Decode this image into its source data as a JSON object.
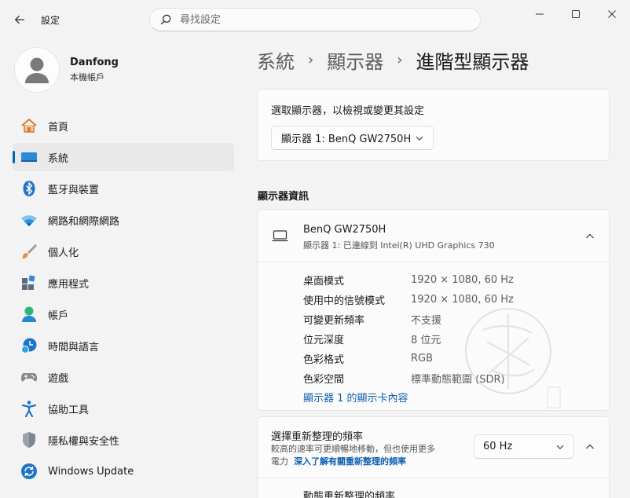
{
  "app": {
    "title": "設定"
  },
  "search": {
    "placeholder": "尋找設定"
  },
  "profile": {
    "name": "Danfong",
    "account_type": "本機帳戶"
  },
  "nav": {
    "items": [
      {
        "label": "首頁",
        "icon": "home-icon"
      },
      {
        "label": "系統",
        "icon": "system-icon",
        "active": true
      },
      {
        "label": "藍牙與裝置",
        "icon": "bluetooth-icon"
      },
      {
        "label": "網路和網際網路",
        "icon": "wifi-icon"
      },
      {
        "label": "個人化",
        "icon": "brush-icon"
      },
      {
        "label": "應用程式",
        "icon": "apps-icon"
      },
      {
        "label": "帳戶",
        "icon": "account-icon"
      },
      {
        "label": "時間與語言",
        "icon": "time-language-icon"
      },
      {
        "label": "遊戲",
        "icon": "gamepad-icon"
      },
      {
        "label": "協助工具",
        "icon": "accessibility-icon"
      },
      {
        "label": "隱私權與安全性",
        "icon": "shield-icon"
      },
      {
        "label": "Windows Update",
        "icon": "update-icon"
      }
    ]
  },
  "breadcrumb": {
    "item1": "系統",
    "item2": "顯示器",
    "current": "進階型顯示器",
    "separator": "›"
  },
  "select_display": {
    "label": "選取顯示器，以檢視或變更其設定",
    "selected": "顯示器 1: BenQ GW2750H"
  },
  "display_info": {
    "section_title": "顯示器資訊",
    "monitor_name": "BenQ GW2750H",
    "monitor_connection": "顯示器 1: 已連線到 Intel(R) UHD Graphics 730",
    "specs": [
      {
        "key": "桌面模式",
        "value": "1920 × 1080, 60 Hz"
      },
      {
        "key": "使用中的信號模式",
        "value": "1920 × 1080, 60 Hz"
      },
      {
        "key": "可變更新頻率",
        "value": "不支援"
      },
      {
        "key": "位元深度",
        "value": "8 位元"
      },
      {
        "key": "色彩格式",
        "value": "RGB"
      },
      {
        "key": "色彩空間",
        "value": "標準動態範圍 (SDR)"
      }
    ],
    "adapter_link": "顯示器 1 的顯示卡內容"
  },
  "refresh_rate": {
    "title": "選擇重新整理的頻率",
    "desc_line1": "較高的速率可更順暢地移動，但也使用更多",
    "desc_line2_prefix": "電力",
    "learn_more": "深入了解有關重新整理的頻率",
    "selected": "60 Hz",
    "dynamic_label": "動態重新整理的頻率"
  },
  "colors": {
    "accent": "#0067c0",
    "link": "#0f5fb0",
    "background": "#f3f3f3",
    "card": "#fbfbfb"
  }
}
